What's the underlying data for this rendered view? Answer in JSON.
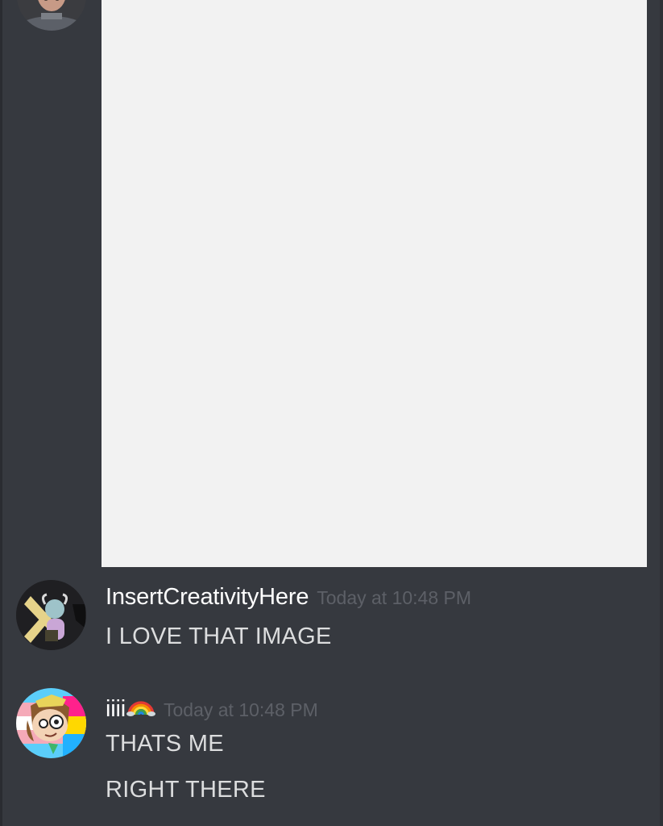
{
  "colors": {
    "background": "#36393f",
    "username": "#ffffff",
    "timestamp": "#5d6067",
    "message_text": "#dcddde",
    "image_placeholder": "#f2f2f2"
  },
  "messages": [
    {
      "avatar_icon": "user-avatar-icon",
      "attachment": "image-attachment"
    },
    {
      "username": "InsertCreativityHere",
      "timestamp": "Today at 10:48 PM",
      "avatar_icon": "character-avatar-icon",
      "lines": [
        "I LOVE THAT IMAGE"
      ]
    },
    {
      "username": "iiii",
      "username_emoji": "rainbow-icon",
      "timestamp": "Today at 10:48 PM",
      "avatar_icon": "cartoon-avatar-icon",
      "lines": [
        "THATS ME",
        "RIGHT THERE"
      ]
    }
  ]
}
